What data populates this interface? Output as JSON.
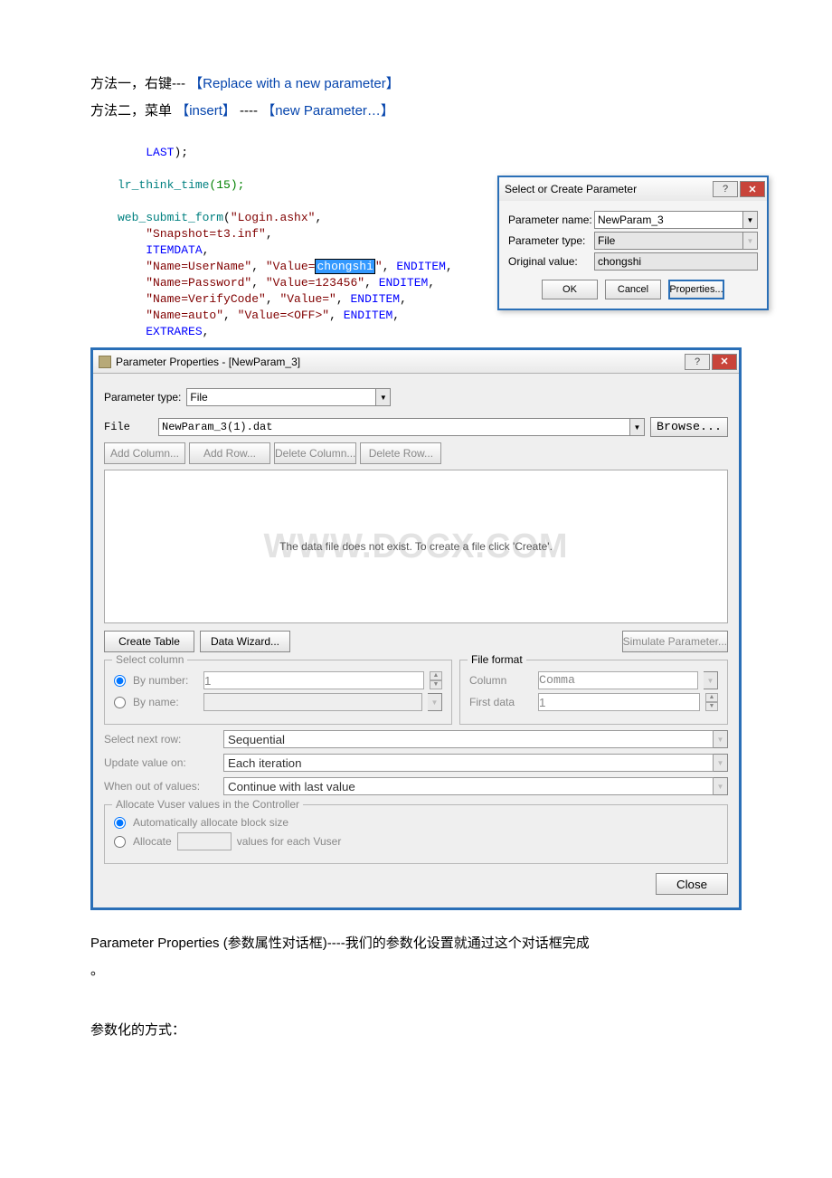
{
  "intro": {
    "line1_pre": "方法一，右键--- ",
    "line1_blue": "【Replace with a new parameter】",
    "line2_pre": "方法二，菜单",
    "line2_blue1": "【insert】",
    "line2_mid": " ---- ",
    "line2_blue2": "【new Parameter…】"
  },
  "code": {
    "last": "LAST",
    "paren_semi": ");",
    "think": "lr_think_time",
    "think_arg": "(15);",
    "web": "web_submit_form",
    "web_open": "(",
    "web_q1": "\"Login.ashx\"",
    "comma": ",",
    "snap": "\"Snapshot=t3.inf\"",
    "itemdata": "ITEMDATA",
    "l1a": "\"Name=UserName\"",
    "l1b": "\"Value=",
    "sel": "chongshi",
    "l1c": "\"",
    "end": "ENDITEM",
    "l2a": "\"Name=Password\"",
    "l2b": "\"Value=123456\"",
    "l3a": "\"Name=VerifyCode\"",
    "l3b": "\"Value=\"",
    "l4a": "\"Name=auto\"",
    "l4b": "\"Value=<OFF>\"",
    "extrares": "EXTRARES"
  },
  "dlg1": {
    "title": "Select or Create Parameter",
    "help": "?",
    "close_x": "✕",
    "pname_label": "Parameter name:",
    "pname_val": "NewParam_3",
    "ptype_label": "Parameter type:",
    "ptype_val": "File",
    "orig_label": "Original value:",
    "orig_val": "chongshi",
    "ok": "OK",
    "cancel": "Cancel",
    "props": "Properties..."
  },
  "dlg2": {
    "title": "Parameter Properties - [NewParam_3]",
    "help": "?",
    "close_x": "✕",
    "ptype_label": "Parameter type:",
    "ptype_val": "File",
    "file_label": "File",
    "file_val": "NewParam_3(1).dat",
    "browse": "Browse...",
    "btns": {
      "add_col": "Add Column...",
      "add_row": "Add Row...",
      "del_col": "Delete Column...",
      "del_row": "Delete Row..."
    },
    "empty_msg": "The data file does not exist. To create a file click 'Create'.",
    "watermark": "www.docx.com",
    "create_table": "Create Table",
    "data_wizard": "Data Wizard...",
    "sim_param": "Simulate Parameter...",
    "sel_col_leg": "Select column",
    "by_number": "By number:",
    "by_number_val": "1",
    "by_name": "By name:",
    "ff_leg": "File format",
    "ff_column": "Column",
    "ff_column_val": "Comma",
    "ff_first": "First data",
    "ff_first_val": "1",
    "next_row_label": "Select next row:",
    "next_row_val": "Sequential",
    "update_label": "Update value on:",
    "update_val": "Each iteration",
    "outof_label": "When out of values:",
    "outof_val": "Continue with last value",
    "alloc_leg": "Allocate Vuser values in the Controller",
    "auto_alloc": "Automatically allocate block size",
    "alloc_label": "Allocate",
    "alloc_suffix": "values for each Vuser",
    "close": "Close"
  },
  "outro": {
    "line1_a": "Parameter Properties (参数属性对话框)----我们的参数化设置就通过这个对话框完成",
    "dot": "。",
    "line2": "参数化的方式："
  }
}
